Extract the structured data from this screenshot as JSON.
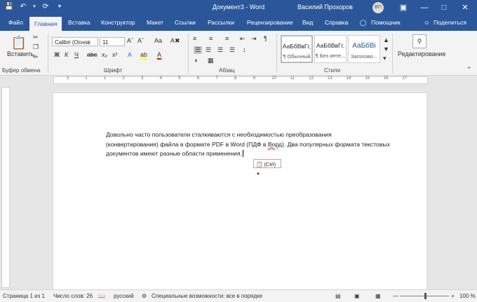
{
  "window": {
    "title": "Документ3 - Word",
    "user_name": "Василий Прохоров",
    "user_initials": "ВП",
    "accent": "#2b579a"
  },
  "qat": {
    "save_icon": "save-icon",
    "undo_icon": "undo-icon",
    "redo_icon": "redo-icon",
    "customize_icon": "chevron-down-icon"
  },
  "tabs": [
    "Файл",
    "Главная",
    "Вставка",
    "Конструктор",
    "Макет",
    "Ссылки",
    "Рассылки",
    "Рецензирование",
    "Вид",
    "Справка"
  ],
  "tell_me": "Помощник",
  "share": "Поделиться",
  "ribbon": {
    "clipboard": {
      "label": "Буфер обмена",
      "paste_label": "Вставить"
    },
    "font": {
      "label": "Шрифт",
      "font_name": "Calibri (Основ",
      "font_size": "11"
    },
    "paragraph": {
      "label": "Абзац"
    },
    "styles": {
      "label": "Стили",
      "items": [
        {
          "sample": "АаБбВвГг,",
          "name": "¶ Обычный"
        },
        {
          "sample": "АаБбВвГг,",
          "name": "¶ Без инте..."
        },
        {
          "sample": "АаБбВі",
          "name": "Заголово..."
        }
      ]
    },
    "editing": {
      "label": "Редактирование"
    }
  },
  "ruler": {
    "top_marks": [
      "3",
      "1",
      "1",
      "2",
      "3",
      "4",
      "5",
      "6",
      "7",
      "8",
      "9",
      "10",
      "11",
      "12",
      "13",
      "14",
      "15",
      "16",
      "17"
    ]
  },
  "document": {
    "lines": [
      "Довольно часто пользователи сталкиваются с необходимостью преобразования",
      "(конвертирования) файла в формате PDF в Word (ПДФ в ",
      "документов имеют разные области применения."
    ],
    "misspelled": "Ворд",
    "line2_tail": "). Два популярных формата текстовых"
  },
  "paste_options": "(Ctrl)",
  "status": {
    "page": "Страница 1 из 1",
    "words": "Число слов: 26",
    "language": "русский",
    "accessibility": "Специальные возможности: все в порядке",
    "zoom": "100 %"
  }
}
